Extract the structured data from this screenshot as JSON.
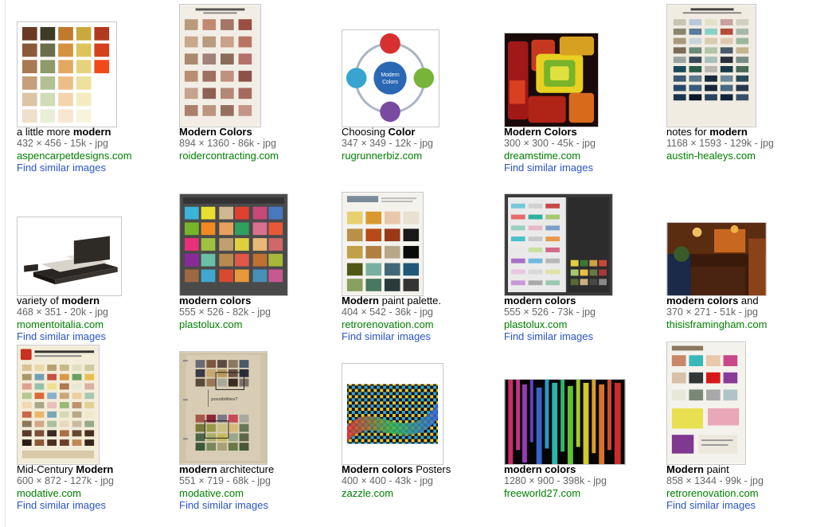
{
  "results": [
    {
      "title_pre": "a little more ",
      "title_bold": "modern",
      "title_post": "",
      "meta": "432 × 456 - 15k - jpg",
      "site": "aspencarpetdesigns.com",
      "similar": "Find similar images"
    },
    {
      "title_pre": "",
      "title_bold": "Modern Colors",
      "title_post": "",
      "meta": "894 × 1360 - 86k - jpg",
      "site": "roidercontracting.com",
      "similar": ""
    },
    {
      "title_pre": "Choosing ",
      "title_bold": "Color",
      "title_post": "",
      "meta": "347 × 349 - 12k - jpg",
      "site": "rugrunnerbiz.com",
      "similar": ""
    },
    {
      "title_pre": "",
      "title_bold": "Modern Colors",
      "title_post": "",
      "meta": "300 × 300 - 45k - jpg",
      "site": "dreamstime.com",
      "similar": "Find similar images"
    },
    {
      "title_pre": "notes for ",
      "title_bold": "modern",
      "title_post": "",
      "meta": "1168 × 1593 - 129k - jpg",
      "site": "austin-healeys.com",
      "similar": ""
    },
    {
      "title_pre": "variety of ",
      "title_bold": "modern",
      "title_post": "",
      "meta": "468 × 351 - 20k - jpg",
      "site": "momentoitalia.com",
      "similar": "Find similar images"
    },
    {
      "title_pre": "",
      "title_bold": "modern colors",
      "title_post": "",
      "meta": "555 × 526 - 82k - jpg",
      "site": "plastolux.com",
      "similar": ""
    },
    {
      "title_pre": "",
      "title_bold": "Modern",
      "title_post": " paint palette.",
      "meta": "404 × 542 - 36k - jpg",
      "site": "retrorenovation.com",
      "similar": "Find similar images"
    },
    {
      "title_pre": "",
      "title_bold": "modern colors",
      "title_post": "",
      "meta": "555 × 526 - 73k - jpg",
      "site": "plastolux.com",
      "similar": "Find similar images"
    },
    {
      "title_pre": "",
      "title_bold": "modern colors",
      "title_post": " and",
      "meta": "370 × 271 - 51k - jpg",
      "site": "thisisframingham.com",
      "similar": ""
    },
    {
      "title_pre": "Mid-Century ",
      "title_bold": "Modern",
      "title_post": "",
      "meta": "600 × 872 - 127k - jpg",
      "site": "modative.com",
      "similar": "Find similar images"
    },
    {
      "title_pre": "",
      "title_bold": "modern",
      "title_post": " architecture",
      "meta": "551 × 719 - 68k - jpg",
      "site": "modative.com",
      "similar": "Find similar images"
    },
    {
      "title_pre": "",
      "title_bold": "Modern colors",
      "title_post": " Posters",
      "meta": "400 × 400 - 43k - jpg",
      "site": "zazzle.com",
      "similar": ""
    },
    {
      "title_pre": "",
      "title_bold": "modern colors",
      "title_post": "",
      "meta": "1280 × 900 - 398k - jpg",
      "site": "freeworld27.com",
      "similar": ""
    },
    {
      "title_pre": "",
      "title_bold": "Modern",
      "title_post": " paint",
      "meta": "858 × 1344 - 99k - jpg",
      "site": "retrorenovation.com",
      "similar": "Find similar images"
    }
  ],
  "thumb_text": {
    "modern_colors_center": "Modern Colors"
  },
  "colors": {
    "site_green": "#008000",
    "link_blue": "#2a55c9",
    "meta_gray": "#666666"
  }
}
